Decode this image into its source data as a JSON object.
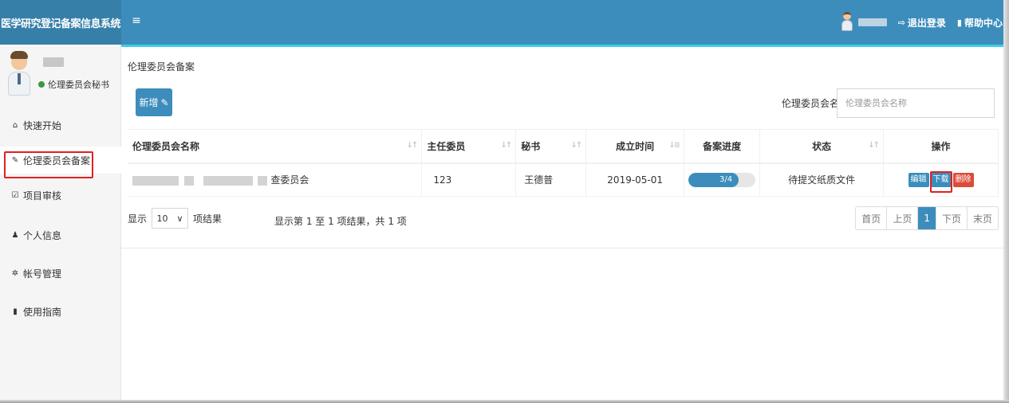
{
  "app": {
    "title": "医学研究登记备案信息系统"
  },
  "header": {
    "menu_icon": "≡",
    "logout_label": "退出登录",
    "help_label": "帮助中心"
  },
  "sidebar": {
    "role": "伦理委员会秘书",
    "items": [
      {
        "label": "快速开始",
        "icon": "home-icon"
      },
      {
        "label": "伦理委员会备案",
        "icon": "pencil-icon"
      },
      {
        "label": "项目审核",
        "icon": "check-square-icon"
      },
      {
        "label": "个人信息",
        "icon": "user-icon"
      },
      {
        "label": "帐号管理",
        "icon": "gears-icon"
      },
      {
        "label": "使用指南",
        "icon": "book-icon"
      }
    ]
  },
  "main": {
    "page_title": "伦理委员会备案",
    "add_button": "新增",
    "search": {
      "label": "伦理委员会名称",
      "placeholder": "伦理委员会名称"
    },
    "table": {
      "headers": [
        "伦理委员会名称",
        "主任委员",
        "秘书",
        "成立时间",
        "备案进度",
        "状态",
        "操作"
      ],
      "rows": [
        {
          "name_suffix": "查委员会",
          "director": "123",
          "secretary": "王德普",
          "established": "2019-05-01",
          "progress_label": "3/4",
          "progress": 0.75,
          "status": "待提交纸质文件",
          "actions": {
            "edit": "编辑",
            "download": "下载",
            "delete": "删除"
          }
        }
      ]
    },
    "length": {
      "prefix": "显示",
      "value": "10",
      "suffix": "项结果"
    },
    "info": "显示第 1 至 1 项结果，共 1 项",
    "pager": {
      "first": "首页",
      "prev": "上页",
      "current": "1",
      "next": "下页",
      "last": "末页"
    }
  }
}
